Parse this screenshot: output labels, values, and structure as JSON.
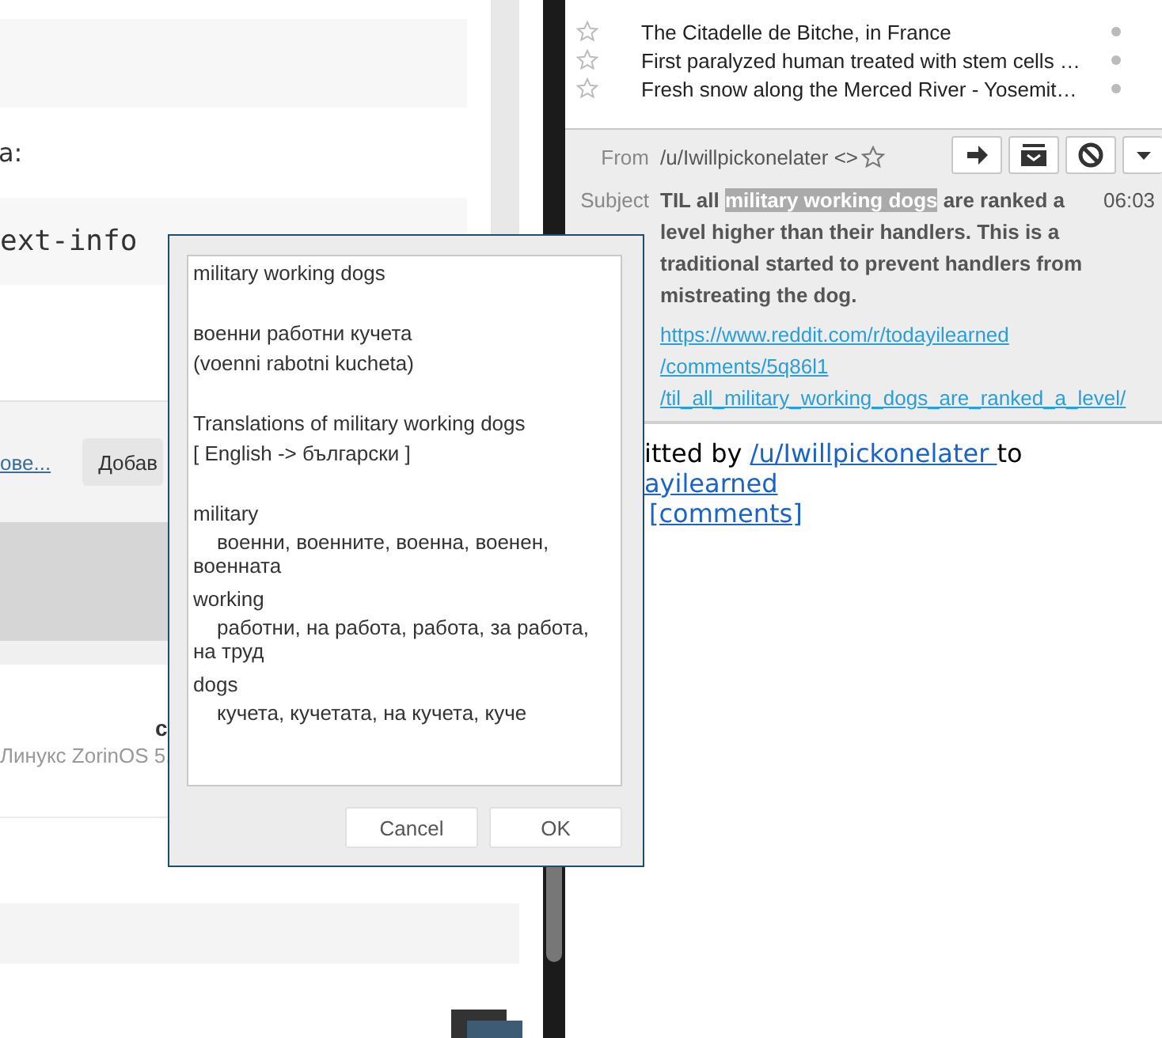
{
  "left_page": {
    "label_text": "a:",
    "code_text": "ext-info",
    "footer_link": "ове...",
    "footer_button": "Добав",
    "author_initial": "c",
    "system_text": "Линукс ZorinOS 5."
  },
  "message_list": [
    {
      "subject": "The Citadelle de Bitche, in France",
      "starred": false
    },
    {
      "subject": "First paralyzed human treated with stem cells …",
      "starred": false
    },
    {
      "subject": "Fresh snow along the Merced River - Yosemit…",
      "starred": false
    }
  ],
  "message_header": {
    "from_label": "From",
    "from_value": "/u/Iwillpickonelater <>",
    "subject_label": "Subject",
    "subject_parts": [
      {
        "text": "TIL all ",
        "highlighted": false
      },
      {
        "text": "military working dogs",
        "highlighted": true
      },
      {
        "text": " are ranked a level higher than their handlers. This is a traditional started to prevent handlers from mistreating the dog.",
        "highlighted": false
      }
    ],
    "time": "06:03",
    "link_lines": [
      "https://www.reddit.com/r/todayilearned",
      "/comments/5q86l1",
      "/til_all_military_working_dogs_are_ranked_a_level/"
    ]
  },
  "message_body": {
    "submitted_text": "itted by ",
    "user_link": "/u/Iwillpickonelater ",
    "to_text": "to",
    "subreddit_link": "ayilearned",
    "comments_link": "[comments]"
  },
  "dialog": {
    "lines": [
      {
        "kind": "text",
        "text": "military working dogs"
      },
      {
        "kind": "blank"
      },
      {
        "kind": "text",
        "text": "военни работни кучета"
      },
      {
        "kind": "text",
        "text": "(voenni rabotni kucheta)"
      },
      {
        "kind": "blank"
      },
      {
        "kind": "text",
        "text": "Translations of military working dogs"
      },
      {
        "kind": "text",
        "text": "[ English -> български ]"
      },
      {
        "kind": "blank"
      },
      {
        "kind": "text",
        "text": "military"
      },
      {
        "kind": "indented",
        "text": "военни, военните, военна, военен, военната"
      },
      {
        "kind": "text",
        "text": "working"
      },
      {
        "kind": "indented",
        "text": "работни, на работа, работа, за работа, на труд"
      },
      {
        "kind": "text",
        "text": "dogs"
      },
      {
        "kind": "indented",
        "text": "кучета, кучетата, на кучета, куче"
      }
    ],
    "buttons": [
      "Cancel",
      "OK"
    ]
  }
}
